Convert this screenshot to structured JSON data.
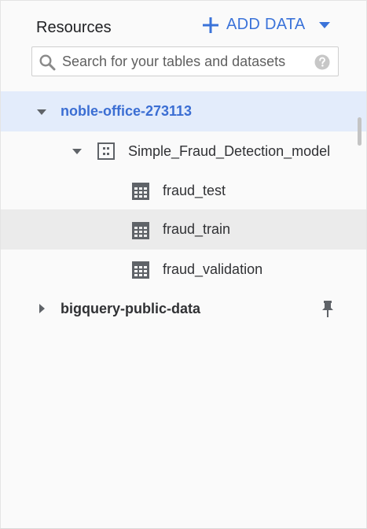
{
  "panel": {
    "title": "Resources",
    "add_data_label": "ADD DATA"
  },
  "search": {
    "placeholder": "Search for your tables and datasets"
  },
  "tree": {
    "project": {
      "name": "noble-office-273113",
      "expanded": true
    },
    "dataset": {
      "name": "Simple_Fraud_Detection_model",
      "expanded": true
    },
    "tables": [
      {
        "name": "fraud_test",
        "icon": "table-icon"
      },
      {
        "name": "fraud_train",
        "icon": "table-icon"
      },
      {
        "name": "fraud_validation",
        "icon": "table-icon"
      }
    ],
    "pinned_project": {
      "name": "bigquery-public-data",
      "expanded": false
    }
  },
  "colors": {
    "accent": "#3b73d9",
    "selected_bg": "#e3ecfb",
    "hover_bg": "#ebebeb",
    "icon_grey": "#5f6368"
  }
}
